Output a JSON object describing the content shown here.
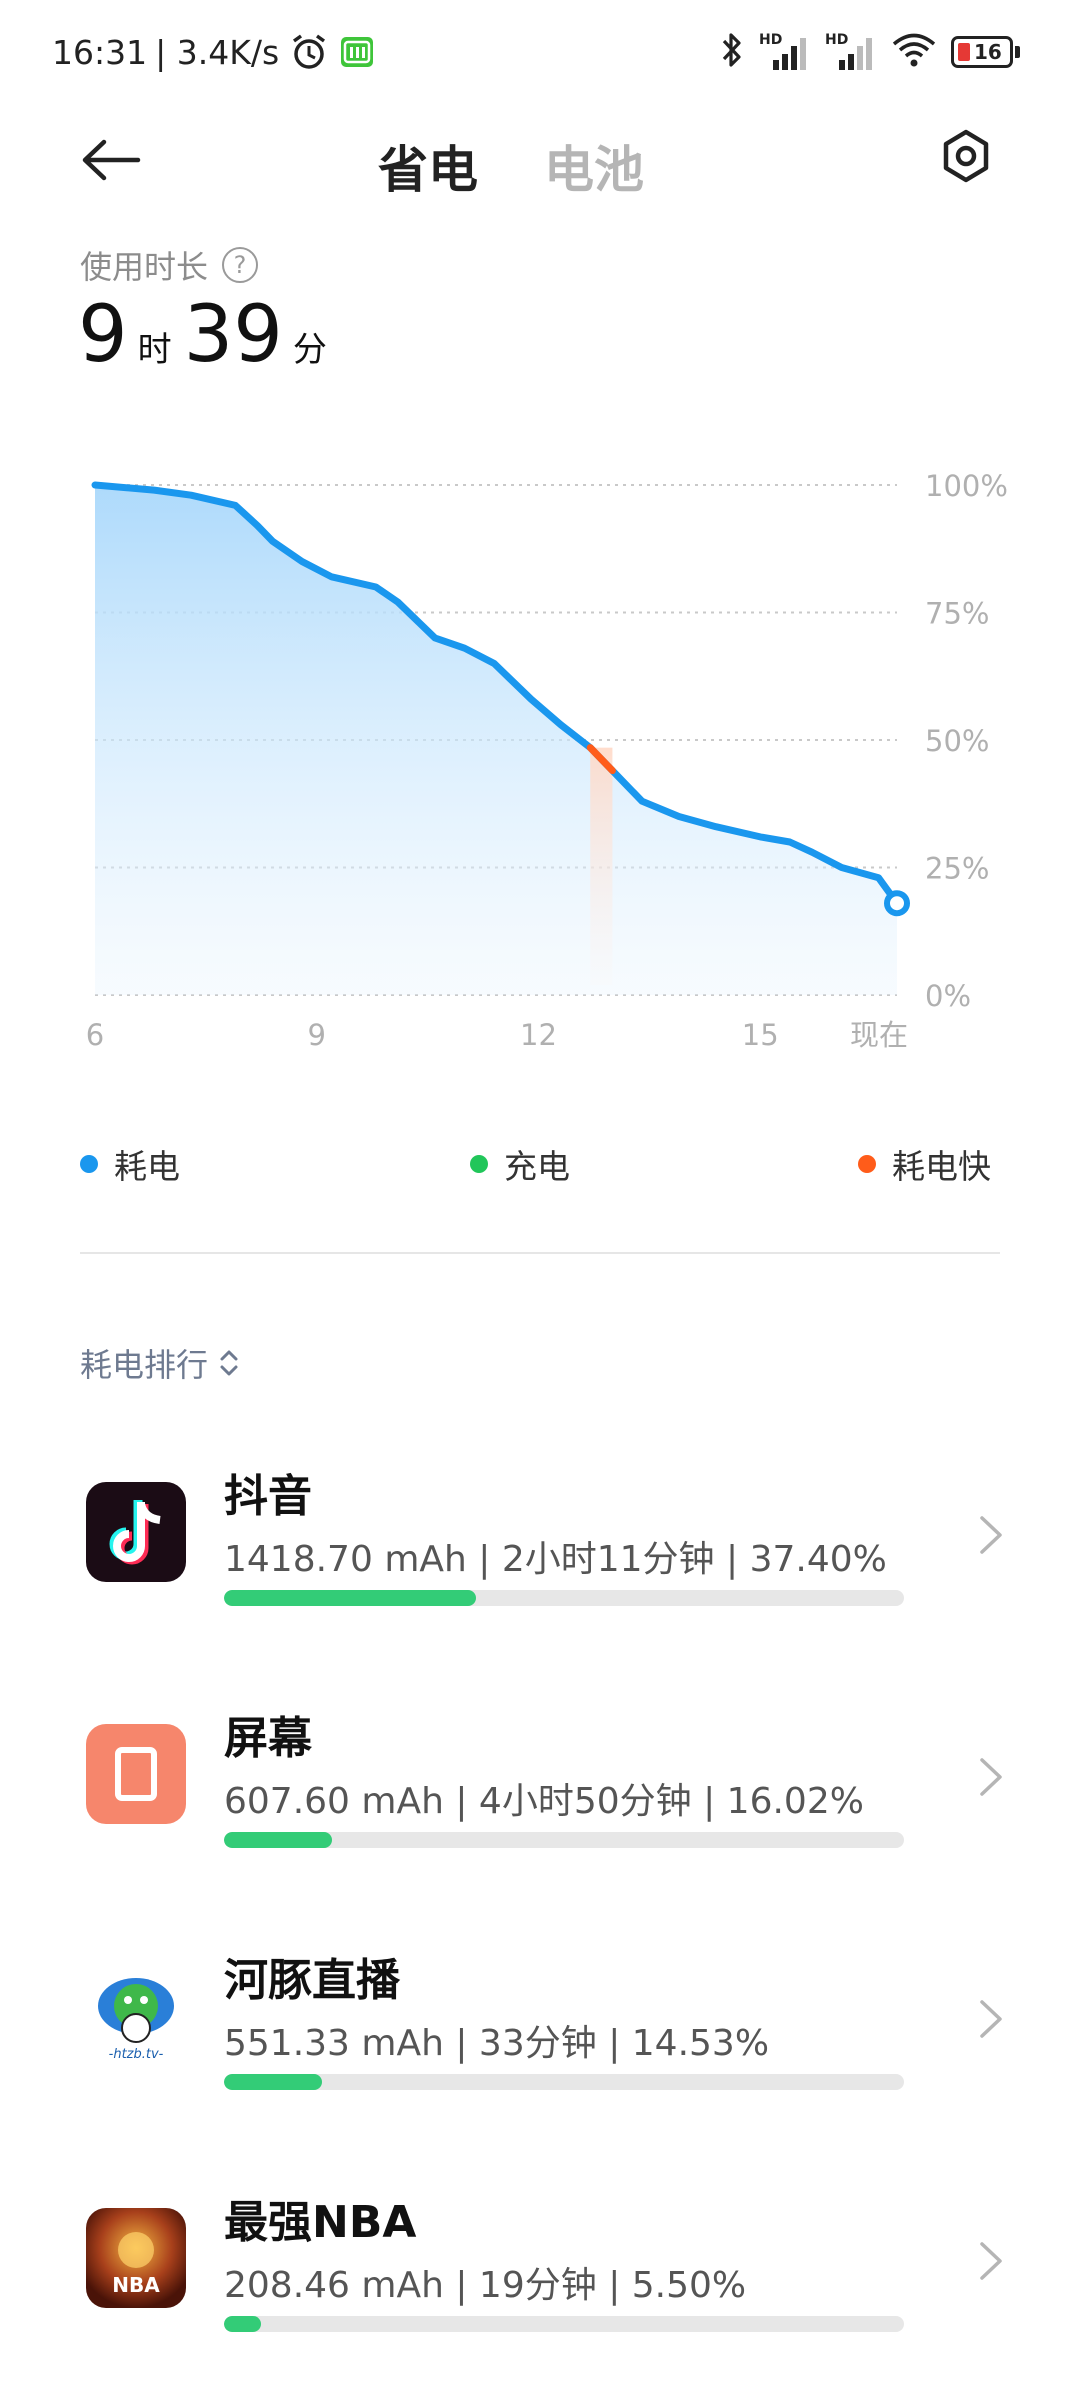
{
  "status_bar": {
    "time": "16:31",
    "speed": "| 3.4K/s",
    "battery_level": "16",
    "alarm_icon": "alarm-clock-icon",
    "app_icon": "iqiyi-icon",
    "bluetooth_icon": "bluetooth-icon",
    "sim_label_1": "HD",
    "sim_label_2": "HD",
    "wifi_icon": "wifi-icon"
  },
  "header": {
    "back_icon": "arrow-left-icon",
    "tabs": [
      {
        "label": "省电",
        "active": true
      },
      {
        "label": "电池",
        "active": false
      }
    ],
    "settings_icon": "hexagon-gear-icon"
  },
  "usage": {
    "label": "使用时长",
    "help_icon": "question-circle-icon",
    "hours": "9",
    "hours_unit": "时",
    "minutes": "39",
    "minutes_unit": "分"
  },
  "chart_data": {
    "type": "area",
    "x_ticks": [
      "6",
      "9",
      "12",
      "15",
      "现在"
    ],
    "y_ticks": [
      "100%",
      "75%",
      "50%",
      "25%",
      "0%"
    ],
    "ylim": [
      0,
      100
    ],
    "xlim": [
      6,
      16.85
    ],
    "series": [
      {
        "name": "耗电",
        "color": "#1a97ee",
        "points": [
          [
            6.0,
            100
          ],
          [
            6.8,
            99
          ],
          [
            7.3,
            98
          ],
          [
            7.9,
            96
          ],
          [
            8.2,
            92
          ],
          [
            8.4,
            89
          ],
          [
            8.8,
            85
          ],
          [
            9.2,
            82
          ],
          [
            9.8,
            80
          ],
          [
            10.1,
            77
          ],
          [
            10.6,
            70
          ],
          [
            11.0,
            68
          ],
          [
            11.4,
            65
          ],
          [
            11.9,
            58
          ],
          [
            12.3,
            53
          ],
          [
            12.7,
            48.5
          ],
          [
            13.0,
            44
          ],
          [
            13.4,
            38
          ],
          [
            13.9,
            35
          ],
          [
            14.4,
            33
          ],
          [
            15.0,
            31
          ],
          [
            15.4,
            30
          ],
          [
            15.7,
            28
          ],
          [
            16.1,
            25
          ],
          [
            16.6,
            23
          ],
          [
            16.85,
            18
          ]
        ]
      }
    ],
    "fast_drain_segment": {
      "name": "耗电快",
      "color": "#ff5c1a",
      "x_range": [
        12.7,
        13.0
      ]
    },
    "legend": [
      {
        "label": "耗电",
        "color": "#1a97ee"
      },
      {
        "label": "充电",
        "color": "#21c65a"
      },
      {
        "label": "耗电快",
        "color": "#ff5c1a"
      }
    ]
  },
  "ranking": {
    "title": "耗电排行",
    "sort_icon": "sort-up-down-icon",
    "chevron_icon": "chevron-right-icon",
    "apps": [
      {
        "name": "抖音",
        "detail": "1418.70 mAh | 2小时11分钟 | 37.40%",
        "share": 0.374,
        "icon": "douyin-icon"
      },
      {
        "name": "屏幕",
        "detail": "607.60 mAh | 4小时50分钟 | 16.02%",
        "share": 0.1602,
        "icon": "screen-icon"
      },
      {
        "name": "河豚直播",
        "detail": "551.33 mAh | 33分钟 | 14.53%",
        "share": 0.1453,
        "icon": "hetun-live-icon",
        "icon_text": "-htzb.tv-"
      },
      {
        "name": "最强NBA",
        "detail": "208.46 mAh | 19分钟 | 5.50%",
        "share": 0.055,
        "icon": "nba-game-icon",
        "icon_text": "NBA"
      }
    ]
  }
}
